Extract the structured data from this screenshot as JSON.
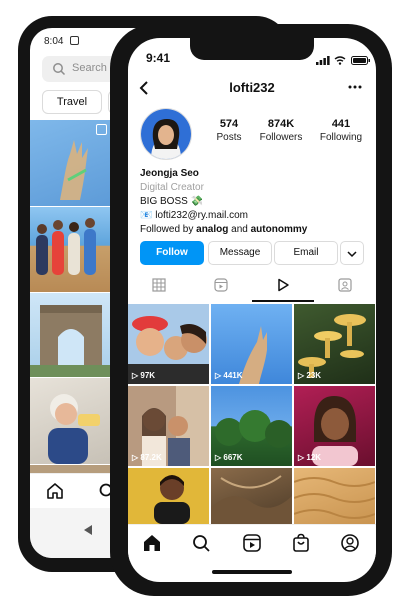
{
  "android": {
    "status_time": "8:04",
    "search_placeholder": "Search",
    "chip_label": "Travel"
  },
  "iphone": {
    "status_time": "9:41",
    "header": {
      "username": "lofti232"
    },
    "stats": [
      {
        "value": "574",
        "label": "Posts"
      },
      {
        "value": "874K",
        "label": "Followers"
      },
      {
        "value": "441",
        "label": "Following"
      }
    ],
    "bio": {
      "name": "Jeongja Seo",
      "category": "Digital Creator",
      "line1": "BIG BOSS 💸",
      "email": "📧 lofti232@ry.mail.com",
      "followed_prefix": "Followed by ",
      "followed_1": "analog",
      "followed_and": " and ",
      "followed_2": "autonommy"
    },
    "buttons": {
      "follow": "Follow",
      "message": "Message",
      "email": "Email"
    },
    "reels": [
      {
        "views": "97K"
      },
      {
        "views": "441K"
      },
      {
        "views": "23K"
      },
      {
        "views": "87.2K"
      },
      {
        "views": "667K"
      },
      {
        "views": "12K"
      }
    ],
    "colors": {
      "follow_blue": "#0095f6",
      "accent_dark": "#111111"
    }
  }
}
